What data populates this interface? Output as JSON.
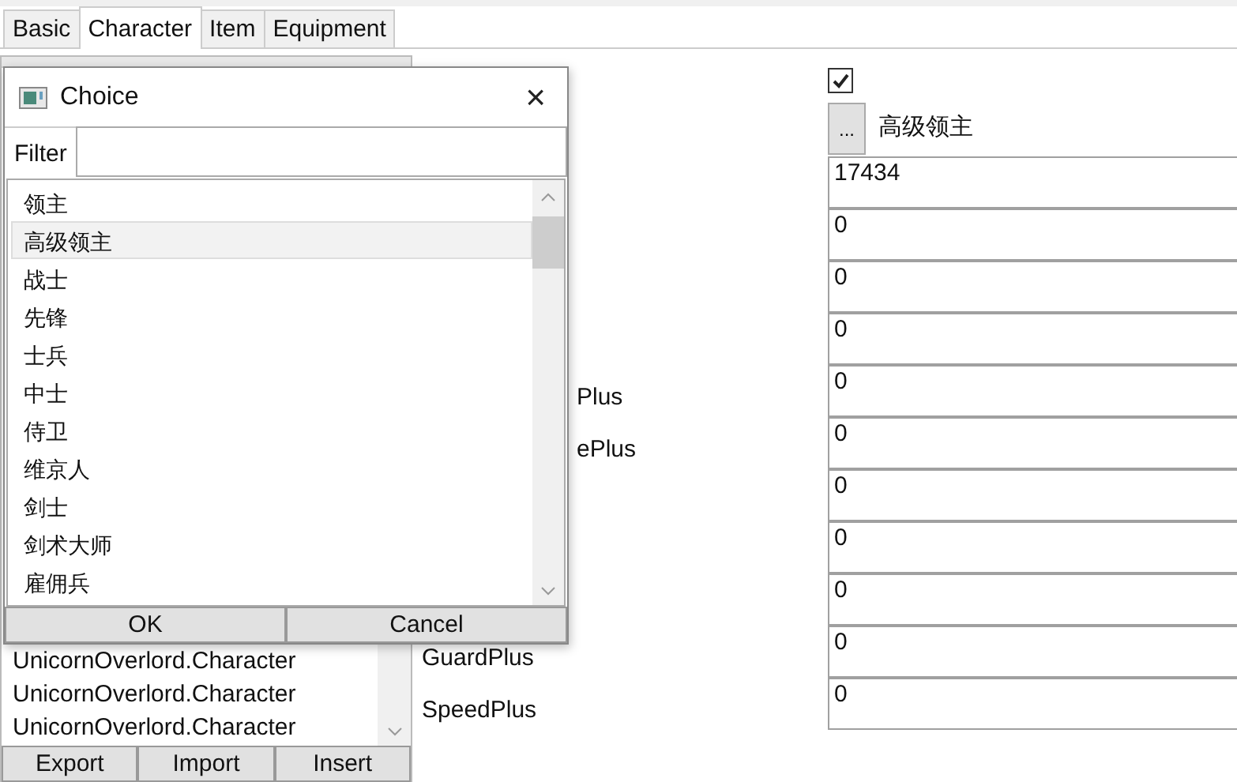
{
  "tabs": [
    {
      "label": "Basic",
      "selected": false
    },
    {
      "label": "Character",
      "selected": true
    },
    {
      "label": "Item",
      "selected": false
    },
    {
      "label": "Equipment",
      "selected": false
    }
  ],
  "list": {
    "rows": [
      "UnicornOverlord.Character",
      "UnicornOverlord.Character",
      "UnicornOverlord.Character"
    ],
    "buttons": [
      "Export",
      "Import",
      "Insert"
    ]
  },
  "editor": {
    "checkbox": {
      "checked": true
    },
    "choice": {
      "button": "...",
      "value": "高级领主"
    },
    "fields": [
      {
        "value": "17434"
      },
      {
        "value": "0"
      },
      {
        "value": "0"
      },
      {
        "value": "0"
      },
      {
        "label": "Plus",
        "cut": true,
        "value": "0"
      },
      {
        "label": "ePlus",
        "cut": true,
        "value": "0"
      },
      {
        "value": "0"
      },
      {
        "value": "0"
      },
      {
        "value": "0"
      },
      {
        "label": "GuardPlus",
        "cut": false,
        "value": "0"
      },
      {
        "label": "SpeedPlus",
        "cut": false,
        "value": "0"
      }
    ]
  },
  "dialog": {
    "title": "Choice",
    "close": "×",
    "filter_label": "Filter",
    "items": [
      {
        "label": "领主",
        "selected": false
      },
      {
        "label": "高级领主",
        "selected": true
      },
      {
        "label": "战士",
        "selected": false
      },
      {
        "label": "先锋",
        "selected": false
      },
      {
        "label": "士兵",
        "selected": false
      },
      {
        "label": "中士",
        "selected": false
      },
      {
        "label": "侍卫",
        "selected": false
      },
      {
        "label": "维京人",
        "selected": false
      },
      {
        "label": "剑士",
        "selected": false
      },
      {
        "label": "剑术大师",
        "selected": false
      },
      {
        "label": "雇佣兵",
        "selected": false
      }
    ],
    "buttons": [
      "OK",
      "Cancel"
    ]
  }
}
